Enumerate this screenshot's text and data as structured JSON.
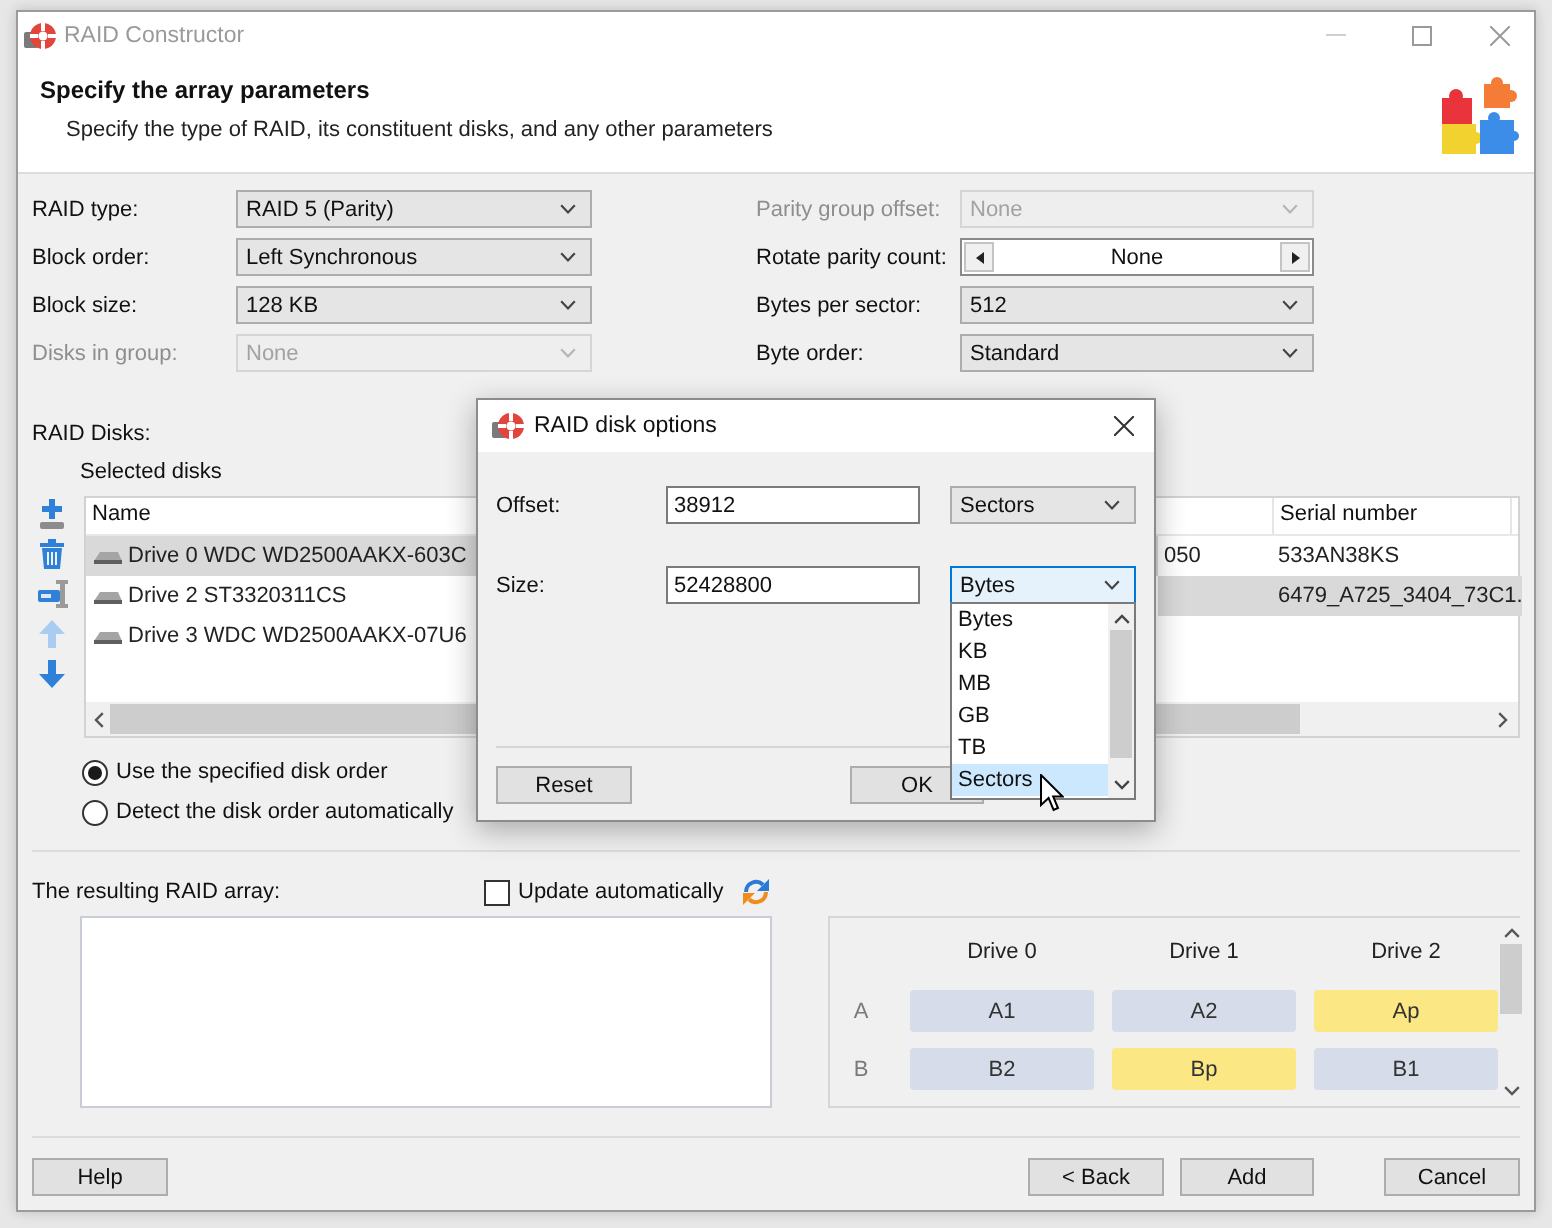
{
  "window": {
    "title": "RAID Constructor"
  },
  "header": {
    "title": "Specify the array parameters",
    "subtitle": "Specify the type of RAID, its constituent disks, and any other parameters"
  },
  "parameters_left": [
    {
      "label": "RAID type:",
      "kind": "dropdown",
      "value": "RAID 5 (Parity)",
      "disabled": false
    },
    {
      "label": "Block order:",
      "kind": "dropdown",
      "value": "Left Synchronous",
      "disabled": false
    },
    {
      "label": "Block size:",
      "kind": "dropdown",
      "value": "128 KB",
      "disabled": false
    },
    {
      "label": "Disks in group:",
      "kind": "dropdown",
      "value": "None",
      "disabled": true
    }
  ],
  "parameters_right": [
    {
      "label": "Parity group offset:",
      "kind": "dropdown",
      "value": "None",
      "disabled": true
    },
    {
      "label": "Rotate parity count:",
      "kind": "spinner",
      "value": "None",
      "disabled": false
    },
    {
      "label": "Bytes per sector:",
      "kind": "dropdown",
      "value": "512",
      "disabled": false
    },
    {
      "label": "Byte order:",
      "kind": "dropdown",
      "value": "Standard",
      "disabled": false
    }
  ],
  "raid_disks": {
    "label": "RAID Disks:",
    "list_label": "Selected disks",
    "tools": [
      {
        "kind": "add",
        "disabled": false
      },
      {
        "kind": "remove",
        "disabled": false
      },
      {
        "kind": "options",
        "disabled": false
      },
      {
        "kind": "move_up",
        "disabled": true
      },
      {
        "kind": "move_down",
        "disabled": false
      }
    ],
    "column_headers": {
      "column_1": "Name",
      "column_3": "Serial number"
    },
    "rows": [
      {
        "cells": [
          {
            "text": "Drive 0 WDC WD2500AAKX-603C",
            "highlighted": true
          },
          {
            "text": "050",
            "highlighted": false
          },
          {
            "text": "533AN38KS",
            "highlighted": false
          }
        ]
      },
      {
        "cells": [
          {
            "text": "Drive 2 ST3320311CS",
            "highlighted": false
          },
          {
            "highlighted": true
          },
          {
            "text": "6479_A725_3404_73C1.",
            "highlighted": true
          }
        ]
      },
      {
        "cells": [
          {
            "text": "Drive 3 WDC WD2500AAKX-07U6",
            "highlighted": false
          },
          {
            "highlighted": false
          },
          {
            "highlighted": false
          }
        ]
      }
    ]
  },
  "disk_order": [
    {
      "label": "Use the specified disk order",
      "selected": true
    },
    {
      "label": "Detect the disk order automatically",
      "selected": false
    }
  ],
  "result": {
    "label": "The resulting RAID array:",
    "update_automatically": {
      "label": "Update automatically",
      "checked": false
    }
  },
  "block_layout": {
    "columns": [
      "Drive 0",
      "Drive 1",
      "Drive 2"
    ],
    "rows": [
      {
        "label": "A",
        "blocks": [
          {
            "text": "A1",
            "color": "#d6dce9"
          },
          {
            "text": "A2",
            "color": "#d6dce9"
          },
          {
            "text": "Ap",
            "color": "#fbe784"
          }
        ]
      },
      {
        "label": "B",
        "blocks": [
          {
            "text": "B2",
            "color": "#d6dce9"
          },
          {
            "text": "Bp",
            "color": "#fbe784"
          },
          {
            "text": "B1",
            "color": "#d6dce9"
          }
        ]
      }
    ]
  },
  "buttons": [
    {
      "kind": "help",
      "label": "Help"
    },
    {
      "kind": "back",
      "label": "< Back"
    },
    {
      "kind": "add",
      "label": "Add"
    },
    {
      "kind": "cancel",
      "label": "Cancel"
    }
  ],
  "dialog": {
    "title": "RAID disk options",
    "fields": [
      {
        "label": "Offset:",
        "value": "38912",
        "unit": "Sectors",
        "open": false
      },
      {
        "label": "Size:",
        "value": "52428800",
        "unit": "Bytes",
        "open": true,
        "options": [
          {
            "label": "Bytes",
            "selected": false
          },
          {
            "label": "KB",
            "selected": false
          },
          {
            "label": "MB",
            "selected": false
          },
          {
            "label": "GB",
            "selected": false
          },
          {
            "label": "TB",
            "selected": false
          },
          {
            "label": "Sectors",
            "selected": true
          }
        ]
      }
    ],
    "buttons": [
      {
        "kind": "reset",
        "label": "Reset"
      },
      {
        "kind": "ok",
        "label": "OK"
      }
    ]
  }
}
